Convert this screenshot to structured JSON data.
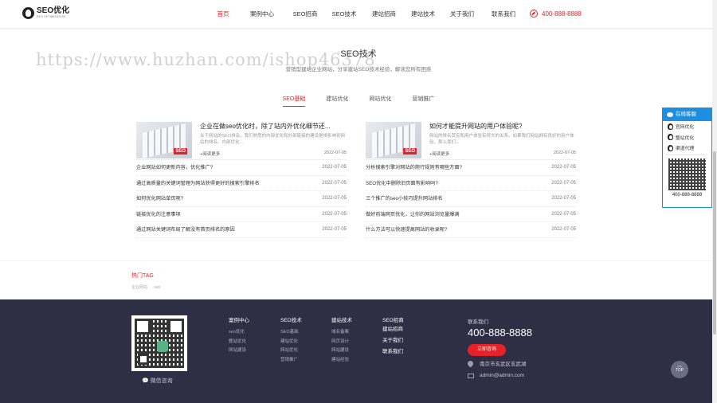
{
  "logo": {
    "title": "SEO优化",
    "subtitle": "SEO OPTIMIZATION"
  },
  "nav": {
    "items": [
      "首页",
      "案例中心",
      "SEO招商",
      "SEO技术",
      "建站招商",
      "建站技术",
      "关于我们",
      "联系我们"
    ],
    "active": "首页"
  },
  "header_phone": "400-888-8888",
  "watermark": "https://www.huzhan.com/ishop46378",
  "section": {
    "title": "SEO技术",
    "desc": "营销型建站企业网站，分享建站SEO技术经验，解读您所有困惑"
  },
  "tabs": [
    "SEO基础",
    "建站优化",
    "网站优化",
    "营销推广"
  ],
  "featured": [
    {
      "title": "企业在做seo优化时，除了站内外优化细节还...",
      "text": "关于网站的SEO排名，我们熟悉的内部优化和外部链接的建设是排影响到网站的排名。内部优化...",
      "more": "+阅读更多",
      "date": "2022-07-05",
      "thumb_tag": "SEO"
    },
    {
      "title": "如何才能提升网站的用户体验呢?",
      "text": "网站的排名其实和用户体验有很大的关系。如果我们网站拥有良好的用户体验，那么我们...",
      "more": "+阅读更多",
      "date": "2022-07-05",
      "thumb_tag": "SEO"
    }
  ],
  "left_list": [
    {
      "title": "企业网站如何更新内容，优化推广?",
      "date": "2022-07-05"
    },
    {
      "title": "通过高质量的关键词管理为网站获得更好的搜索引擎排名",
      "date": "2022-07-05"
    },
    {
      "title": "如何优化网站单页呢?",
      "date": "2022-07-05"
    },
    {
      "title": "链接优化的注意事项",
      "date": "2022-07-05"
    },
    {
      "title": "通过网站关键词布局了解没有首页排名的原因",
      "date": "2022-07-05"
    }
  ],
  "right_list": [
    {
      "title": "分析搜索引擎对网站的爬行规则有哪些方面?",
      "date": "2022-07-05"
    },
    {
      "title": "SEO优化中删除旧页面有影响吗?",
      "date": "2022-07-05"
    },
    {
      "title": "三个推广的seo小技巧提升网站排名",
      "date": "2022-07-05"
    },
    {
      "title": "做好前端网页优化，让你的网站浏览量爆满",
      "date": "2022-07-05"
    },
    {
      "title": "什么方法可以快速提高网站的收录呢?",
      "date": "2022-07-05"
    }
  ],
  "hot_tags": {
    "title": "热门TAG",
    "items": [
      "企业网站",
      "seo"
    ]
  },
  "footer": {
    "wechat_label": "微信咨询",
    "columns": [
      {
        "title": "案例中心",
        "items": [
          "seo优化",
          "整站优化",
          "网站建设"
        ]
      },
      {
        "title": "SEO技术",
        "items": [
          "SEO基础",
          "建站优化",
          "网站优化",
          "营销推广"
        ]
      },
      {
        "title": "建站技术",
        "items": [
          "域名备案",
          "网页设计",
          "网站建设",
          "建站经验"
        ]
      },
      {
        "title": "SEO招商",
        "items": [
          "建站招商",
          "关于我们",
          "联系我们"
        ]
      }
    ],
    "contact_label": "联系我们",
    "phone": "400-888-8888",
    "consult_button": "立即咨询",
    "address": "南京市玄武区玄武湖",
    "email": "admin@admin.com",
    "top_button": "TOP"
  },
  "service": {
    "title": "在线客服",
    "items": [
      "官网优化",
      "整站优化",
      "渠道代理"
    ],
    "phone": "400-888-8888"
  },
  "colors": {
    "accent": "#e62129",
    "footer_bg": "#2e2e45",
    "service_blue": "#1e8fe0"
  }
}
